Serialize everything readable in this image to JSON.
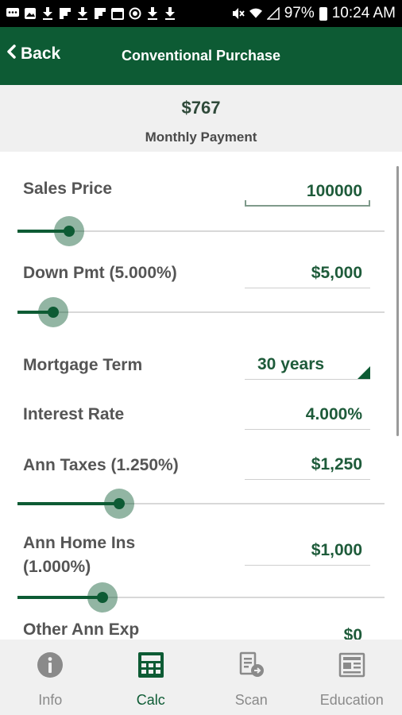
{
  "status_bar": {
    "battery_percent": "97%",
    "time": "10:24 AM"
  },
  "header": {
    "back_label": "Back",
    "title": "Conventional Purchase"
  },
  "summary": {
    "payment_amount": "$767",
    "payment_label": "Monthly Payment"
  },
  "form": {
    "sales_price": {
      "label": "Sales Price",
      "value": "100000",
      "slider_fraction": 0.1
    },
    "down_payment": {
      "label": "Down Pmt (5.000%)",
      "value": "$5,000",
      "slider_fraction": 0.05
    },
    "mortgage_term": {
      "label": "Mortgage Term",
      "value": "30 years"
    },
    "interest_rate": {
      "label": "Interest Rate",
      "value": "4.000%"
    },
    "annual_taxes": {
      "label": "Ann Taxes (1.250%)",
      "value": "$1,250",
      "slider_fraction": 0.25
    },
    "annual_home_insurance": {
      "label_line1": "Ann Home Ins",
      "label_line2": "(1.000%)",
      "value": "$1,000",
      "slider_fraction": 0.2
    },
    "other_annual_expense": {
      "label": "Other Ann Exp",
      "value": "$0"
    }
  },
  "bottom_nav": {
    "items": [
      {
        "label": "Info",
        "icon": "info-icon",
        "active": false
      },
      {
        "label": "Calc",
        "icon": "calculator-icon",
        "active": true
      },
      {
        "label": "Scan",
        "icon": "scan-icon",
        "active": false
      },
      {
        "label": "Education",
        "icon": "newspaper-icon",
        "active": false
      }
    ]
  },
  "colors": {
    "brand_green": "#0d5b34",
    "value_green": "#1e5b3a"
  }
}
